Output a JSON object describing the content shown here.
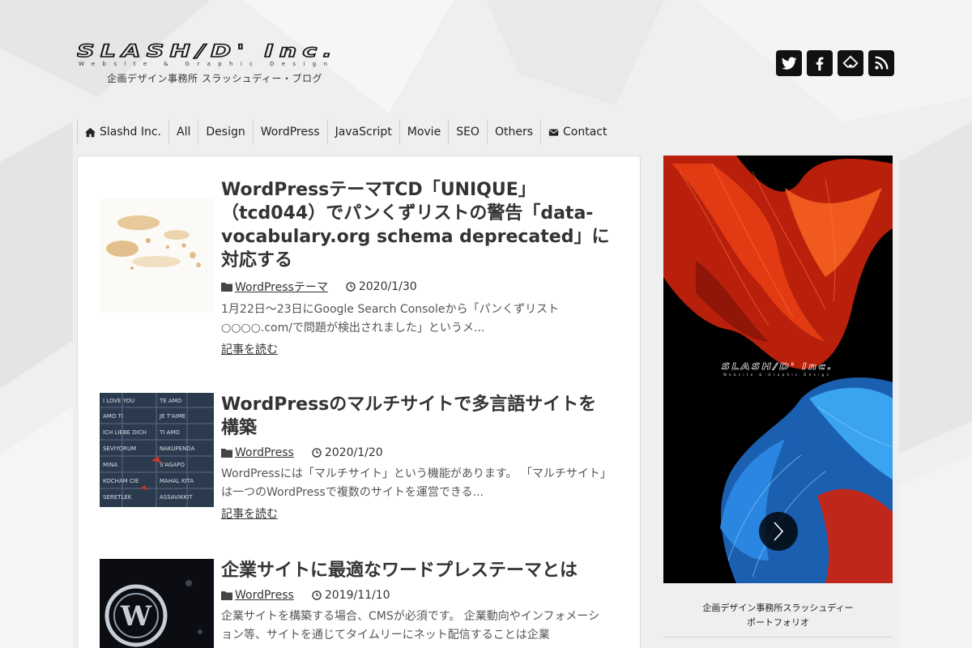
{
  "header": {
    "logo_text": "SLASH/D' Inc.",
    "logo_sub": "Website & Graphic Design",
    "tagline": "企画デザイン事務所 スラッシュディー・ブログ"
  },
  "social": [
    {
      "icon": "twitter-icon"
    },
    {
      "icon": "facebook-icon"
    },
    {
      "icon": "feedly-icon"
    },
    {
      "icon": "rss-icon"
    }
  ],
  "nav": {
    "items": [
      {
        "label": "Slashd Inc.",
        "icon": "home-icon"
      },
      {
        "label": "All"
      },
      {
        "label": "Design"
      },
      {
        "label": "WordPress"
      },
      {
        "label": "JavaScript"
      },
      {
        "label": "Movie"
      },
      {
        "label": "SEO"
      },
      {
        "label": "Others"
      },
      {
        "label": "Contact",
        "icon": "envelope-icon"
      }
    ]
  },
  "posts": [
    {
      "title": "WordPressテーマTCD「UNIQUE」（tcd044）でパンくずリストの警告「data-vocabulary.org schema deprecated」に対応する",
      "category": "WordPressテーマ",
      "date": "2020/1/30",
      "excerpt": "1月22日～23日にGoogle Search Consoleから「パンくずリスト○○○○.com/で問題が検出されました」というメ...",
      "more": "記事を読む"
    },
    {
      "title": "WordPressのマルチサイトで多言語サイトを構築",
      "category": "WordPress",
      "date": "2020/1/20",
      "excerpt": "WordPressには「マルチサイト」という機能があります。 「マルチサイト」は一つのWordPressで複数のサイトを運営できる...",
      "more": "記事を読む"
    },
    {
      "title": "企業サイトに最適なワードプレステーマとは",
      "category": "WordPress",
      "date": "2019/11/10",
      "excerpt": "企業サイトを構築する場合、CMSが必須です。 企業動向やインフォメーション等、サイトを通じてタイムリーにネット配信することは企業"
    }
  ],
  "sidebar": {
    "slide_logo": "SLASH/D' Inc.",
    "slide_logo_sub": "Website & Graphic Design",
    "caption_line1": "企画デザイン事務所スラッシュディー",
    "caption_line2": "ポートフォリオ"
  },
  "colors": {
    "background": "#efefef",
    "card": "#ffffff",
    "text": "#333333",
    "icon_bg": "#111111"
  }
}
